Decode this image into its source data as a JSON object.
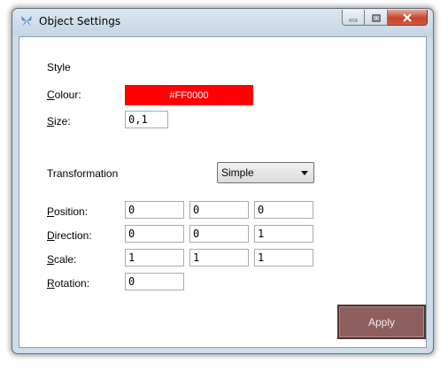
{
  "window": {
    "title": "Object Settings"
  },
  "style": {
    "heading": "Style",
    "colour": {
      "label_key": "C",
      "label_rest": "olour:",
      "value": "#FF0000",
      "swatch_color": "#ff0000"
    },
    "size": {
      "label_key": "S",
      "label_rest": "ize:",
      "value": "0,1"
    }
  },
  "transformation": {
    "heading": "Transformation",
    "mode": {
      "selected": "Simple"
    },
    "position": {
      "label_key": "P",
      "label_rest": "osition:",
      "values": [
        "0",
        "0",
        "0"
      ]
    },
    "direction": {
      "label_key": "D",
      "label_rest": "irection:",
      "values": [
        "0",
        "0",
        "1"
      ]
    },
    "scale": {
      "label_key": "S",
      "label_rest": "cale:",
      "values": [
        "1",
        "1",
        "1"
      ]
    },
    "rotation": {
      "label_key": "R",
      "label_rest": "otation:",
      "value": "0"
    }
  },
  "actions": {
    "apply_label": "Apply"
  },
  "colors": {
    "apply_bg": "#8e5f5f",
    "colour_value": "#ff0000"
  },
  "icons": {
    "app": "butterfly-icon",
    "minimize": "minimize-icon",
    "maximize": "maximize-icon",
    "close": "close-icon"
  }
}
